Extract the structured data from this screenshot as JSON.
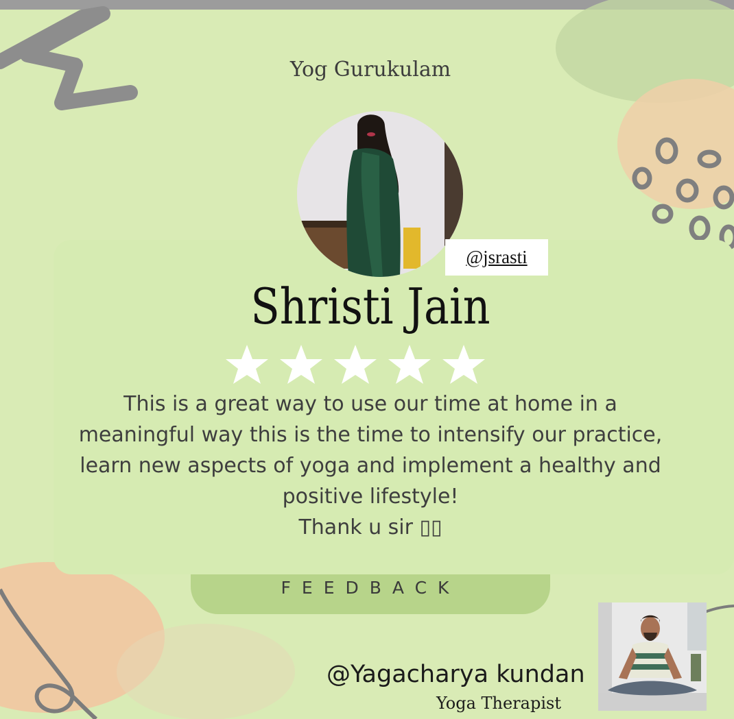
{
  "brand": {
    "title": "Yog Gurukulam"
  },
  "profile": {
    "handle": "@jsrasti",
    "name": "Shristi Jain"
  },
  "rating": {
    "stars": 5,
    "max": 5
  },
  "testimonial": {
    "lines": [
      "This is a great way to use our time at home in a",
      "meaningful way this is the time to intensify our practice,",
      "learn new aspects of yoga and implement a healthy and",
      "positive lifestyle!",
      "Thank u sir ▯▯"
    ]
  },
  "section": {
    "label": "FEEDBACK"
  },
  "author": {
    "handle": "@Yagacharya kundan",
    "title": "Yoga Therapist"
  },
  "colors": {
    "background": "#d9ebb5",
    "pill": "#b7d48a",
    "accent_peach": "#f2c9a0",
    "deco_gray": "#8d8d8d",
    "star": "#ffffff"
  }
}
